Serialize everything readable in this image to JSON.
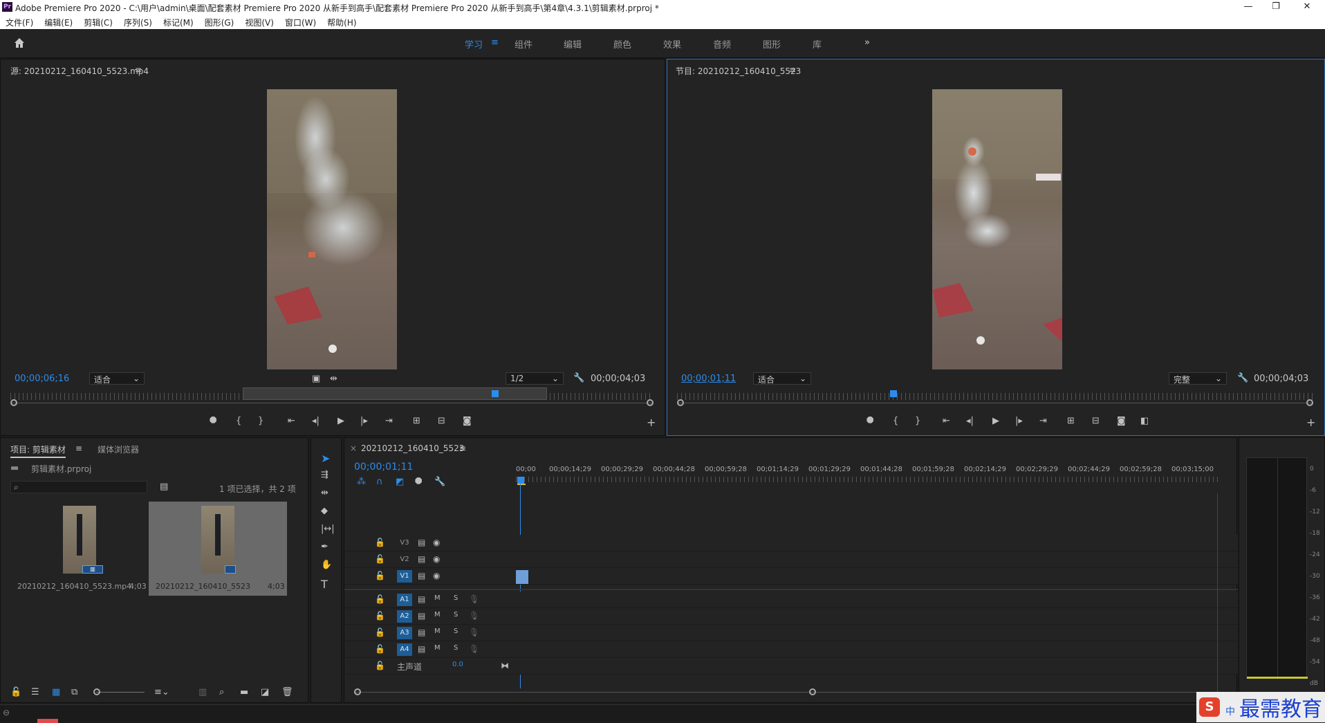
{
  "window": {
    "title": "Adobe Premiere Pro 2020 - C:\\用户\\admin\\桌面\\配套素材 Premiere Pro 2020 从新手到高手\\配套素材 Premiere Pro 2020 从新手到高手\\第4章\\4.3.1\\剪辑素材.prproj *",
    "logo": "Pr",
    "minimize": "—",
    "restore": "❐",
    "close": "✕"
  },
  "menu": [
    "文件(F)",
    "编辑(E)",
    "剪辑(C)",
    "序列(S)",
    "标记(M)",
    "图形(G)",
    "视图(V)",
    "窗口(W)",
    "帮助(H)"
  ],
  "workspaces": {
    "items": [
      "学习",
      "组件",
      "编辑",
      "颜色",
      "效果",
      "音频",
      "图形",
      "库"
    ],
    "active": "学习",
    "more": "»"
  },
  "source": {
    "title": "源: 20210212_160410_5523.mp4",
    "timecode": "00;00;06;16",
    "fit": "适合",
    "resolution": "1/2",
    "duration": "00;00;04;03"
  },
  "program": {
    "title": "节目: 20210212_160410_5523",
    "timecode": "00;00;01;11",
    "fit": "适合",
    "resolution": "完整",
    "duration": "00;00;04;03"
  },
  "project": {
    "tab_active": "项目: 剪辑素材",
    "tab_other": "媒体浏览器",
    "file": "剪辑素材.prproj",
    "selection": "1 项已选择，共 2 项",
    "items": [
      {
        "name": "20210212_160410_5523.mp4",
        "duration": "4;03"
      },
      {
        "name": "20210212_160410_5523",
        "duration": "4;03"
      }
    ]
  },
  "timeline": {
    "tab": "20210212_160410_5523",
    "timecode": "00;00;01;11",
    "ruler": [
      "00;00",
      "00;00;14;29",
      "00;00;29;29",
      "00;00;44;28",
      "00;00;59;28",
      "00;01;14;29",
      "00;01;29;29",
      "00;01;44;28",
      "00;01;59;28",
      "00;02;14;29",
      "00;02;29;29",
      "00;02;44;29",
      "00;02;59;28",
      "00;03;15;00"
    ],
    "video_tracks": [
      "V3",
      "V2",
      "V1"
    ],
    "audio_tracks": [
      "A1",
      "A2",
      "A3",
      "A4"
    ],
    "master": "主声道",
    "master_value": "0.0",
    "mute": "M",
    "solo": "S"
  },
  "meter": {
    "scale": [
      "0",
      "-6",
      "-12",
      "-18",
      "-24",
      "-30",
      "-36",
      "-42",
      "-48",
      "-54",
      "dB"
    ]
  },
  "watermark": {
    "text": "最需教育",
    "cn": "中"
  }
}
